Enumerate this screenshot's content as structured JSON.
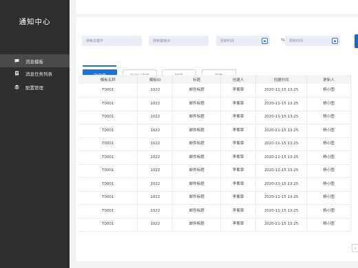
{
  "sidebar": {
    "title": "通知中心",
    "items": [
      {
        "label": "消息模板",
        "icon": "chat-bubble-icon",
        "active": true
      },
      {
        "label": "消息任务列表",
        "icon": "document-icon",
        "active": false
      },
      {
        "label": "配置管理",
        "icon": "layers-icon",
        "active": false
      }
    ]
  },
  "filters": {
    "keyword_placeholder": "搜索关键字",
    "template_id_placeholder": "搜索模板ID",
    "start_time_placeholder": "更新时间",
    "swap_symbol": "⇆",
    "end_time_placeholder": "更新时间"
  },
  "tabs": [
    {
      "label": "站内信",
      "active": true
    },
    {
      "label": "PUSH消息",
      "active": false
    },
    {
      "label": "短信",
      "active": false
    },
    {
      "label": "邮件",
      "active": false
    }
  ],
  "table": {
    "columns": [
      "模板名称",
      "模板ID",
      "标题",
      "创建人",
      "创建时间",
      "更新人"
    ],
    "rows": [
      [
        "T0001",
        "1022",
        "邮件标题",
        "李紫章",
        "2020-11-15 13:25",
        "杨小图"
      ],
      [
        "T0001",
        "1022",
        "邮件标题",
        "李紫章",
        "2020-11-15 13:25",
        "杨小图"
      ],
      [
        "T0001",
        "1022",
        "邮件标题",
        "李紫章",
        "2020-11-15 13:25",
        "杨小图"
      ],
      [
        "T0001",
        "1022",
        "邮件标题",
        "李紫章",
        "2020-11-15 13:25",
        "杨小图"
      ],
      [
        "T0001",
        "1022",
        "邮件标题",
        "李紫章",
        "2020-11-15 13:25",
        "杨小图"
      ],
      [
        "T0001",
        "1022",
        "邮件标题",
        "李紫章",
        "2020-11-15 13:25",
        "杨小图"
      ],
      [
        "T0001",
        "1022",
        "邮件标题",
        "李紫章",
        "2020-11-15 13:25",
        "杨小图"
      ],
      [
        "T0001",
        "1022",
        "邮件标题",
        "李紫章",
        "2020-11-15 13:25",
        "杨小图"
      ],
      [
        "T0001",
        "1022",
        "邮件标题",
        "李紫章",
        "2020-11-15 13:25",
        "杨小图"
      ],
      [
        "T0001",
        "1022",
        "邮件标题",
        "李紫章",
        "2020-11-15 13:25",
        "杨小图"
      ],
      [
        "T0001",
        "1022",
        "邮件标题",
        "李紫章",
        "2020-11-15 13:25",
        "杨小图"
      ]
    ]
  },
  "pager": {
    "prev_symbol": "‹"
  },
  "colors": {
    "sidebar_bg": "#2f2f30",
    "accent": "#1e6fd8",
    "page_bg": "#f2f3f5"
  }
}
